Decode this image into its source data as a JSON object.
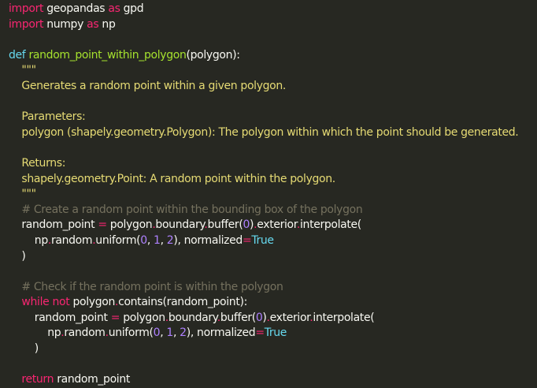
{
  "theme": {
    "background": "#272822",
    "default_text": "#f8f8f2",
    "keyword": "#f92672",
    "def_keyword": "#66d9ef",
    "function_name": "#a6e22e",
    "string": "#e6db74",
    "number": "#ae81ff",
    "comment": "#75715e"
  },
  "code": {
    "lines": [
      [
        {
          "t": "kw",
          "v": "import"
        },
        {
          "t": "txt",
          "v": " geopandas "
        },
        {
          "t": "kw",
          "v": "as"
        },
        {
          "t": "txt",
          "v": " gpd"
        }
      ],
      [
        {
          "t": "kw",
          "v": "import"
        },
        {
          "t": "txt",
          "v": " numpy "
        },
        {
          "t": "kw",
          "v": "as"
        },
        {
          "t": "txt",
          "v": " np"
        }
      ],
      [],
      [
        {
          "t": "def",
          "v": "def"
        },
        {
          "t": "txt",
          "v": " "
        },
        {
          "t": "fn",
          "v": "random_point_within_polygon"
        },
        {
          "t": "txt",
          "v": "(polygon):"
        }
      ],
      [
        {
          "t": "str",
          "v": "    \"\"\""
        }
      ],
      [
        {
          "t": "str",
          "v": "    Generates a random point within a given polygon."
        }
      ],
      [],
      [
        {
          "t": "str",
          "v": "    Parameters:"
        }
      ],
      [
        {
          "t": "str",
          "v": "    polygon (shapely.geometry.Polygon): The polygon within which the point should be generated."
        }
      ],
      [],
      [
        {
          "t": "str",
          "v": "    Returns:"
        }
      ],
      [
        {
          "t": "str",
          "v": "    shapely.geometry.Point: A random point within the polygon."
        }
      ],
      [
        {
          "t": "str",
          "v": "    \"\"\""
        }
      ],
      [
        {
          "t": "cmt",
          "v": "    # Create a random point within the bounding box of the polygon"
        }
      ],
      [
        {
          "t": "txt",
          "v": "    random_point "
        },
        {
          "t": "op",
          "v": "="
        },
        {
          "t": "txt",
          "v": " polygon"
        },
        {
          "t": "dot",
          "v": "."
        },
        {
          "t": "txt",
          "v": "boundary"
        },
        {
          "t": "dot",
          "v": "."
        },
        {
          "t": "txt",
          "v": "buffer("
        },
        {
          "t": "num",
          "v": "0"
        },
        {
          "t": "txt",
          "v": ")"
        },
        {
          "t": "dot",
          "v": "."
        },
        {
          "t": "txt",
          "v": "exterior"
        },
        {
          "t": "dot",
          "v": "."
        },
        {
          "t": "txt",
          "v": "interpolate("
        }
      ],
      [
        {
          "t": "txt",
          "v": "        np"
        },
        {
          "t": "dot",
          "v": "."
        },
        {
          "t": "txt",
          "v": "random"
        },
        {
          "t": "dot",
          "v": "."
        },
        {
          "t": "txt",
          "v": "uniform("
        },
        {
          "t": "num",
          "v": "0"
        },
        {
          "t": "txt",
          "v": ", "
        },
        {
          "t": "num",
          "v": "1"
        },
        {
          "t": "txt",
          "v": ", "
        },
        {
          "t": "num",
          "v": "2"
        },
        {
          "t": "txt",
          "v": "), normalized"
        },
        {
          "t": "op",
          "v": "="
        },
        {
          "t": "def",
          "v": "True"
        }
      ],
      [
        {
          "t": "txt",
          "v": "    )"
        }
      ],
      [],
      [
        {
          "t": "cmt",
          "v": "    # Check if the random point is within the polygon"
        }
      ],
      [
        {
          "t": "kw",
          "v": "    while"
        },
        {
          "t": "txt",
          "v": " "
        },
        {
          "t": "kw",
          "v": "not"
        },
        {
          "t": "txt",
          "v": " polygon"
        },
        {
          "t": "dot",
          "v": "."
        },
        {
          "t": "txt",
          "v": "contains(random_point):"
        }
      ],
      [
        {
          "t": "txt",
          "v": "        random_point "
        },
        {
          "t": "op",
          "v": "="
        },
        {
          "t": "txt",
          "v": " polygon"
        },
        {
          "t": "dot",
          "v": "."
        },
        {
          "t": "txt",
          "v": "boundary"
        },
        {
          "t": "dot",
          "v": "."
        },
        {
          "t": "txt",
          "v": "buffer("
        },
        {
          "t": "num",
          "v": "0"
        },
        {
          "t": "txt",
          "v": ")"
        },
        {
          "t": "dot",
          "v": "."
        },
        {
          "t": "txt",
          "v": "exterior"
        },
        {
          "t": "dot",
          "v": "."
        },
        {
          "t": "txt",
          "v": "interpolate("
        }
      ],
      [
        {
          "t": "txt",
          "v": "            np"
        },
        {
          "t": "dot",
          "v": "."
        },
        {
          "t": "txt",
          "v": "random"
        },
        {
          "t": "dot",
          "v": "."
        },
        {
          "t": "txt",
          "v": "uniform("
        },
        {
          "t": "num",
          "v": "0"
        },
        {
          "t": "txt",
          "v": ", "
        },
        {
          "t": "num",
          "v": "1"
        },
        {
          "t": "txt",
          "v": ", "
        },
        {
          "t": "num",
          "v": "2"
        },
        {
          "t": "txt",
          "v": "), normalized"
        },
        {
          "t": "op",
          "v": "="
        },
        {
          "t": "def",
          "v": "True"
        }
      ],
      [
        {
          "t": "txt",
          "v": "        )"
        }
      ],
      [],
      [
        {
          "t": "kw",
          "v": "    return"
        },
        {
          "t": "txt",
          "v": " random_point"
        }
      ]
    ]
  }
}
